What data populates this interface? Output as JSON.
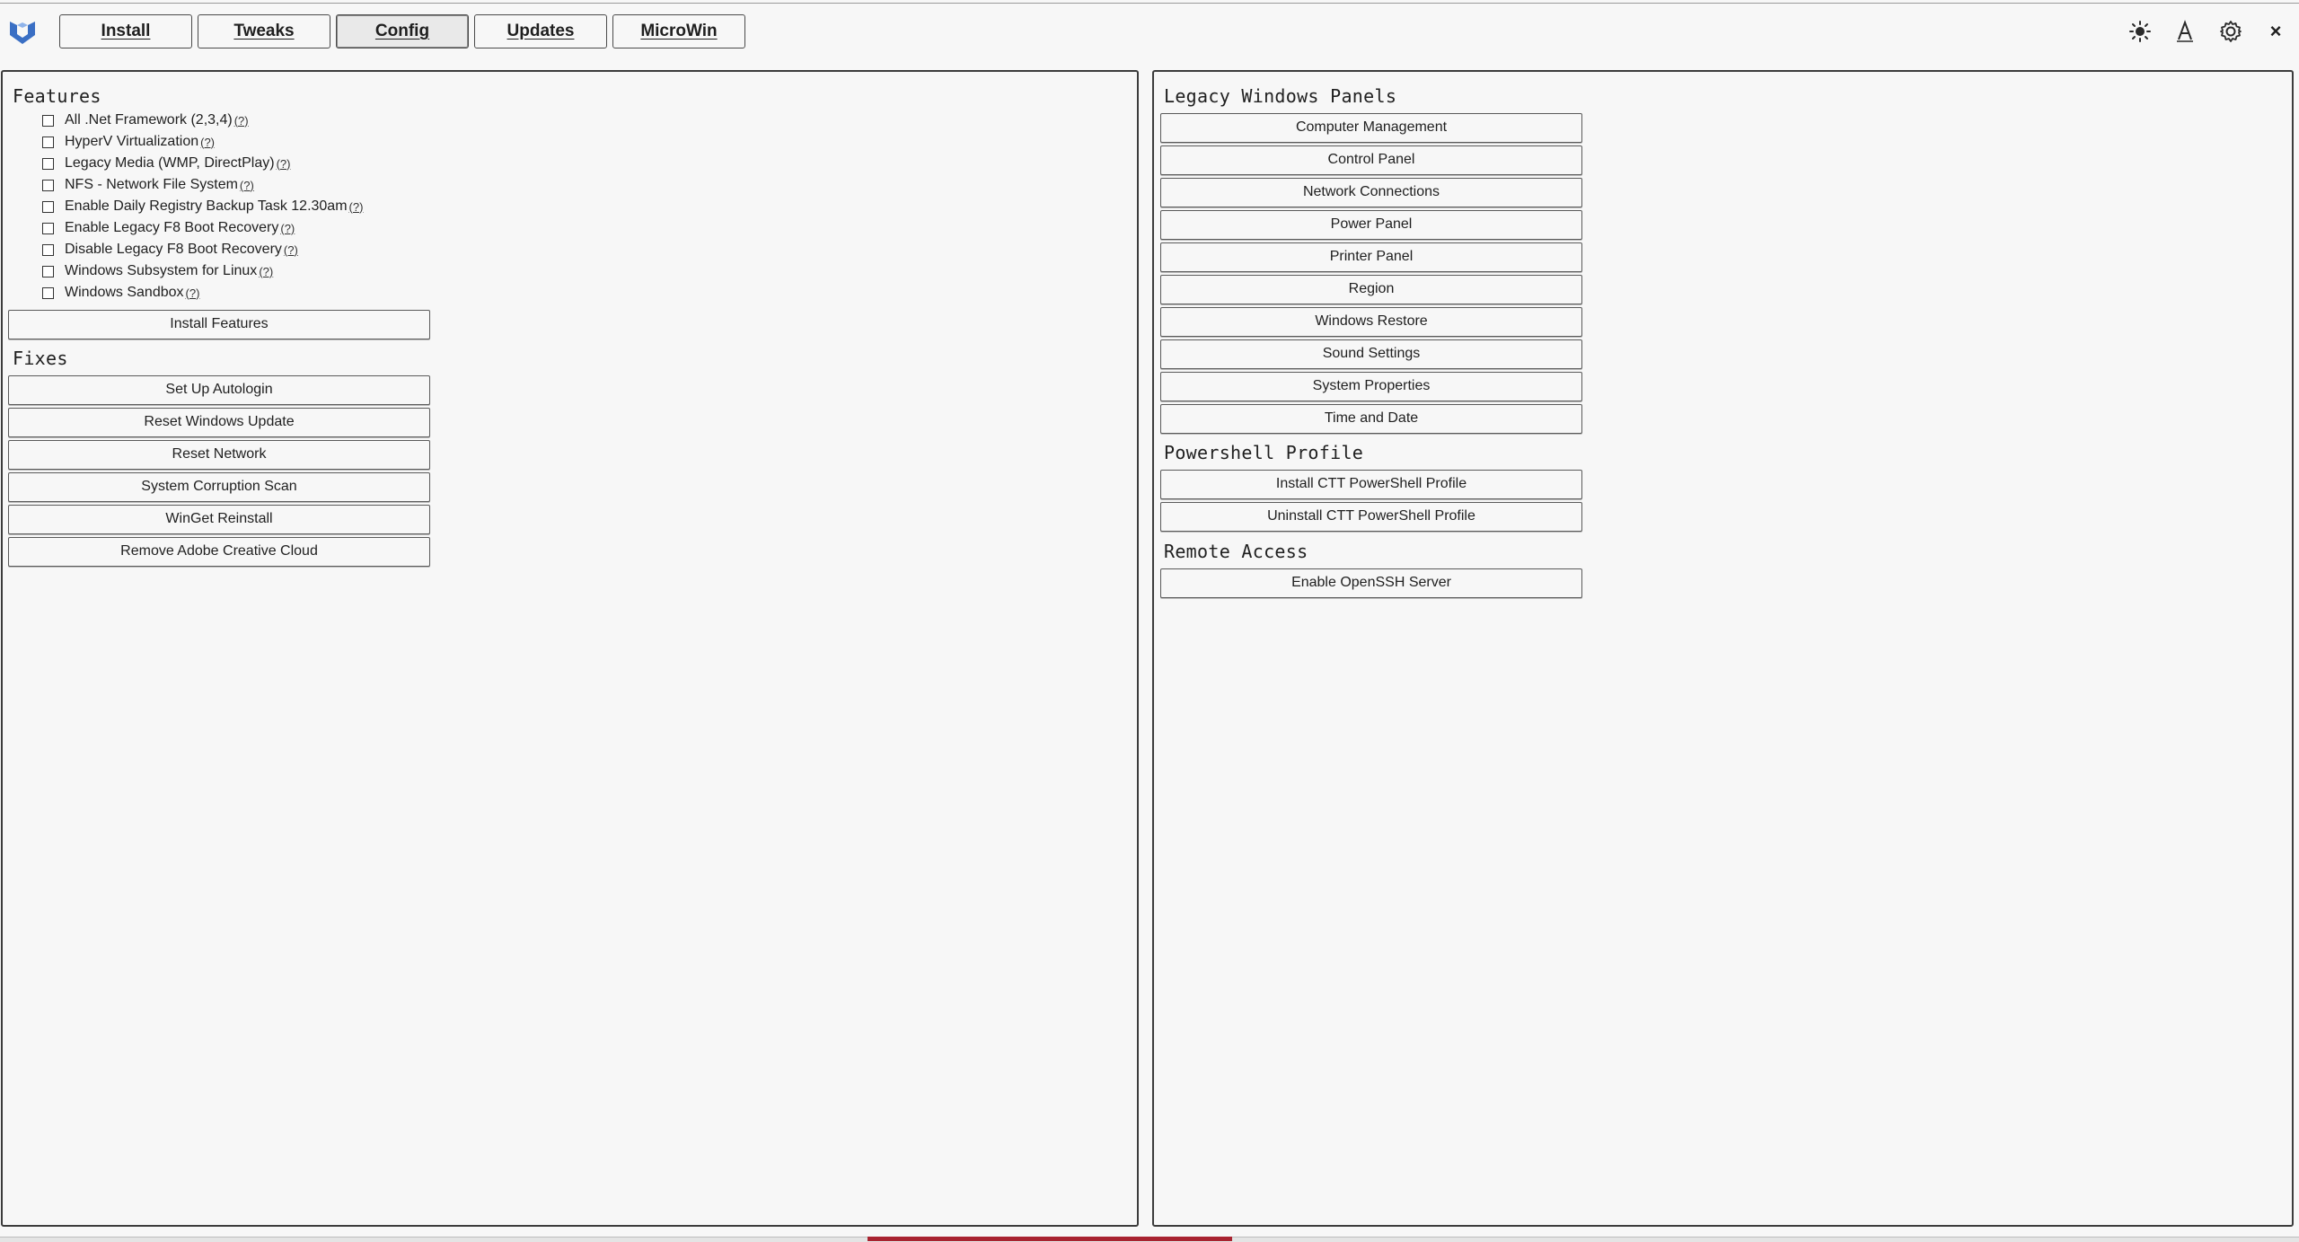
{
  "nav": {
    "tabs": [
      {
        "label": "Install"
      },
      {
        "label": "Tweaks"
      },
      {
        "label": "Config",
        "active": true
      },
      {
        "label": "Updates"
      },
      {
        "label": "MicroWin"
      }
    ]
  },
  "header_icons": [
    "theme-toggle-icon",
    "font-scaling-icon",
    "settings-gear-icon",
    "close-icon"
  ],
  "close_glyph": "×",
  "left": {
    "features": {
      "title": "Features",
      "items": [
        {
          "label": "All .Net Framework (2,3,4)",
          "help": "(?)"
        },
        {
          "label": "HyperV Virtualization",
          "help": "(?)"
        },
        {
          "label": "Legacy Media (WMP, DirectPlay)",
          "help": "(?)"
        },
        {
          "label": "NFS - Network File System",
          "help": "(?)"
        },
        {
          "label": "Enable Daily Registry Backup Task 12.30am",
          "help": "(?)"
        },
        {
          "label": "Enable Legacy F8 Boot Recovery",
          "help": "(?)"
        },
        {
          "label": "Disable Legacy F8 Boot Recovery",
          "help": "(?)"
        },
        {
          "label": "Windows Subsystem for Linux",
          "help": "(?)"
        },
        {
          "label": "Windows Sandbox",
          "help": "(?)"
        }
      ],
      "install_button": "Install Features"
    },
    "fixes": {
      "title": "Fixes",
      "buttons": [
        "Set Up Autologin",
        "Reset Windows Update",
        "Reset Network",
        "System Corruption Scan",
        "WinGet Reinstall",
        "Remove Adobe Creative Cloud"
      ]
    }
  },
  "right": {
    "legacy": {
      "title": "Legacy Windows Panels",
      "buttons": [
        "Computer Management",
        "Control Panel",
        "Network Connections",
        "Power Panel",
        "Printer Panel",
        "Region",
        "Windows Restore",
        "Sound Settings",
        "System Properties",
        "Time and Date"
      ]
    },
    "powershell": {
      "title": "Powershell Profile",
      "buttons": [
        "Install CTT PowerShell Profile",
        "Uninstall CTT PowerShell Profile"
      ]
    },
    "remote": {
      "title": "Remote Access",
      "buttons": [
        "Enable OpenSSH Server"
      ]
    }
  },
  "colors": {
    "background": "#f7f7f7",
    "border": "#3c3c3c",
    "progress": "#a82330",
    "logo": "#3a6fc4"
  }
}
